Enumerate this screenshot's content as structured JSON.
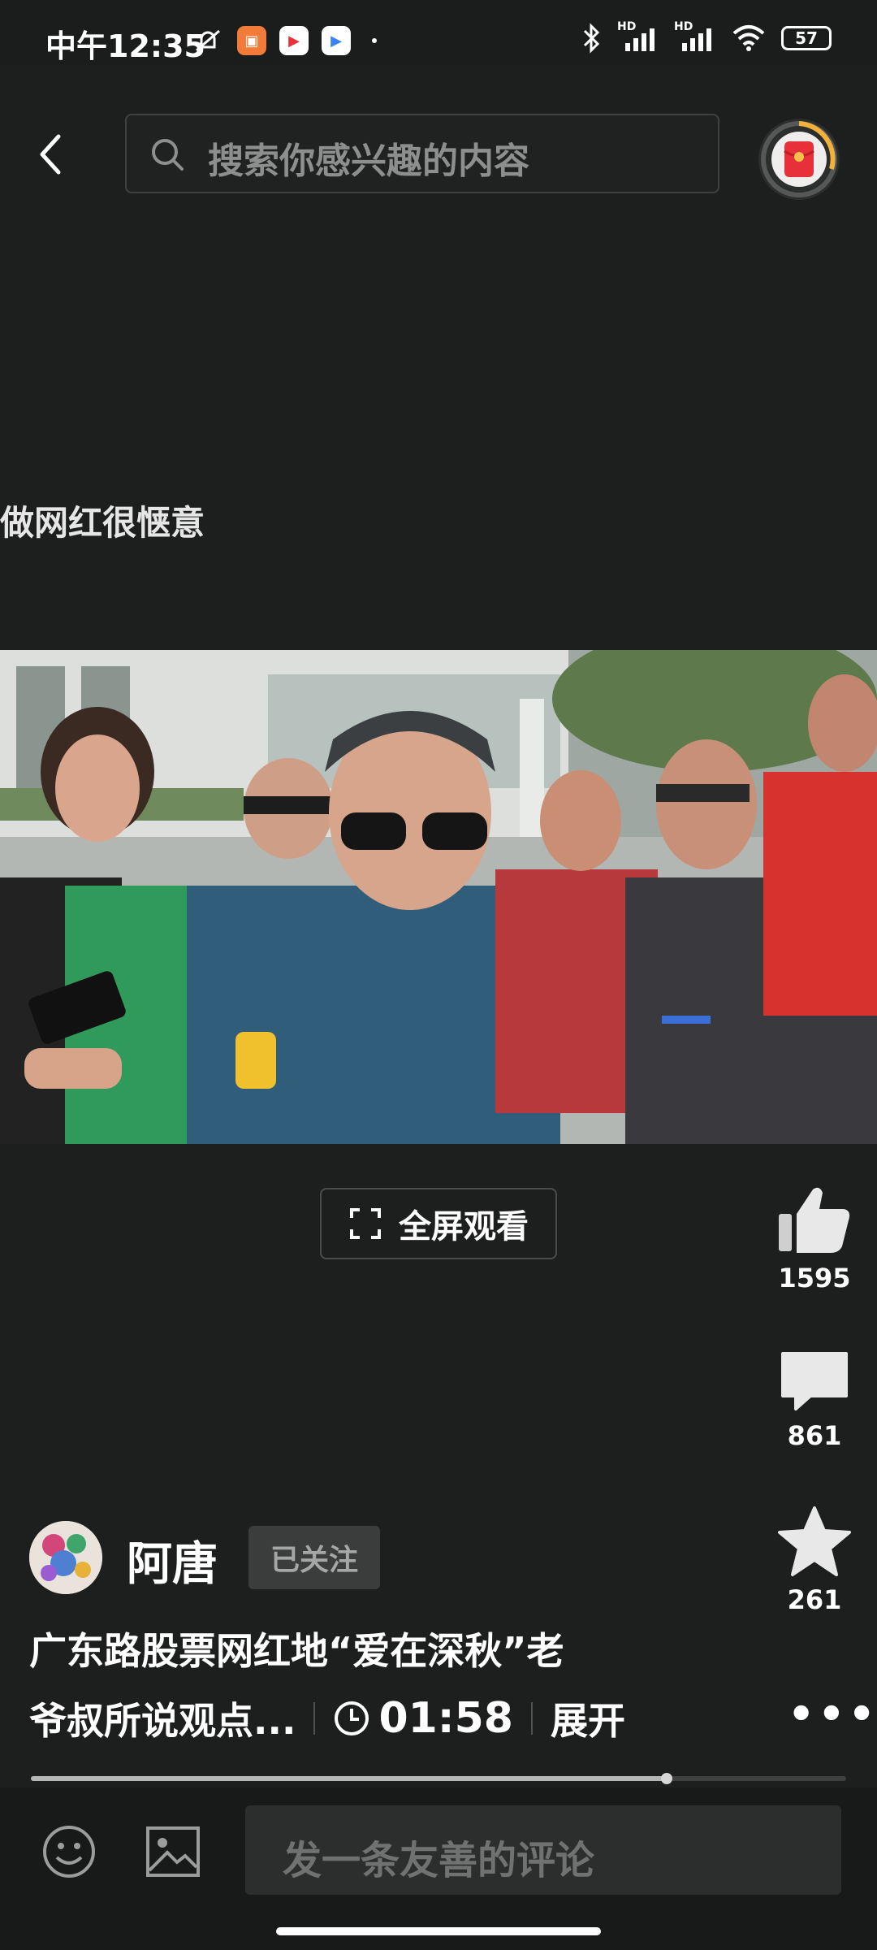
{
  "status_bar": {
    "time": "中午12:35",
    "network_label_1": "HD",
    "network_label_2": "HD",
    "battery": "57"
  },
  "header": {
    "search_placeholder": "搜索你感兴趣的内容"
  },
  "video": {
    "overlay_caption": "做网红很惬意",
    "fullscreen_label": "全屏观看",
    "progress": 0.78
  },
  "actions": {
    "like_count": "1595",
    "comment_count": "861",
    "favorite_count": "261"
  },
  "author": {
    "name": "阿唐",
    "follow_status": "已关注"
  },
  "post": {
    "title_line1": "广东路股票网红地“爱在深秋”老",
    "title_line2": "爷叔所说观点...",
    "duration": "01:58",
    "expand_label": "展开"
  },
  "comment_bar": {
    "placeholder": "发一条友善的评论"
  },
  "colors": {
    "background": "#1c1f1d",
    "accent_red": "#e8303a",
    "ring_orange": "#f2b13b"
  }
}
